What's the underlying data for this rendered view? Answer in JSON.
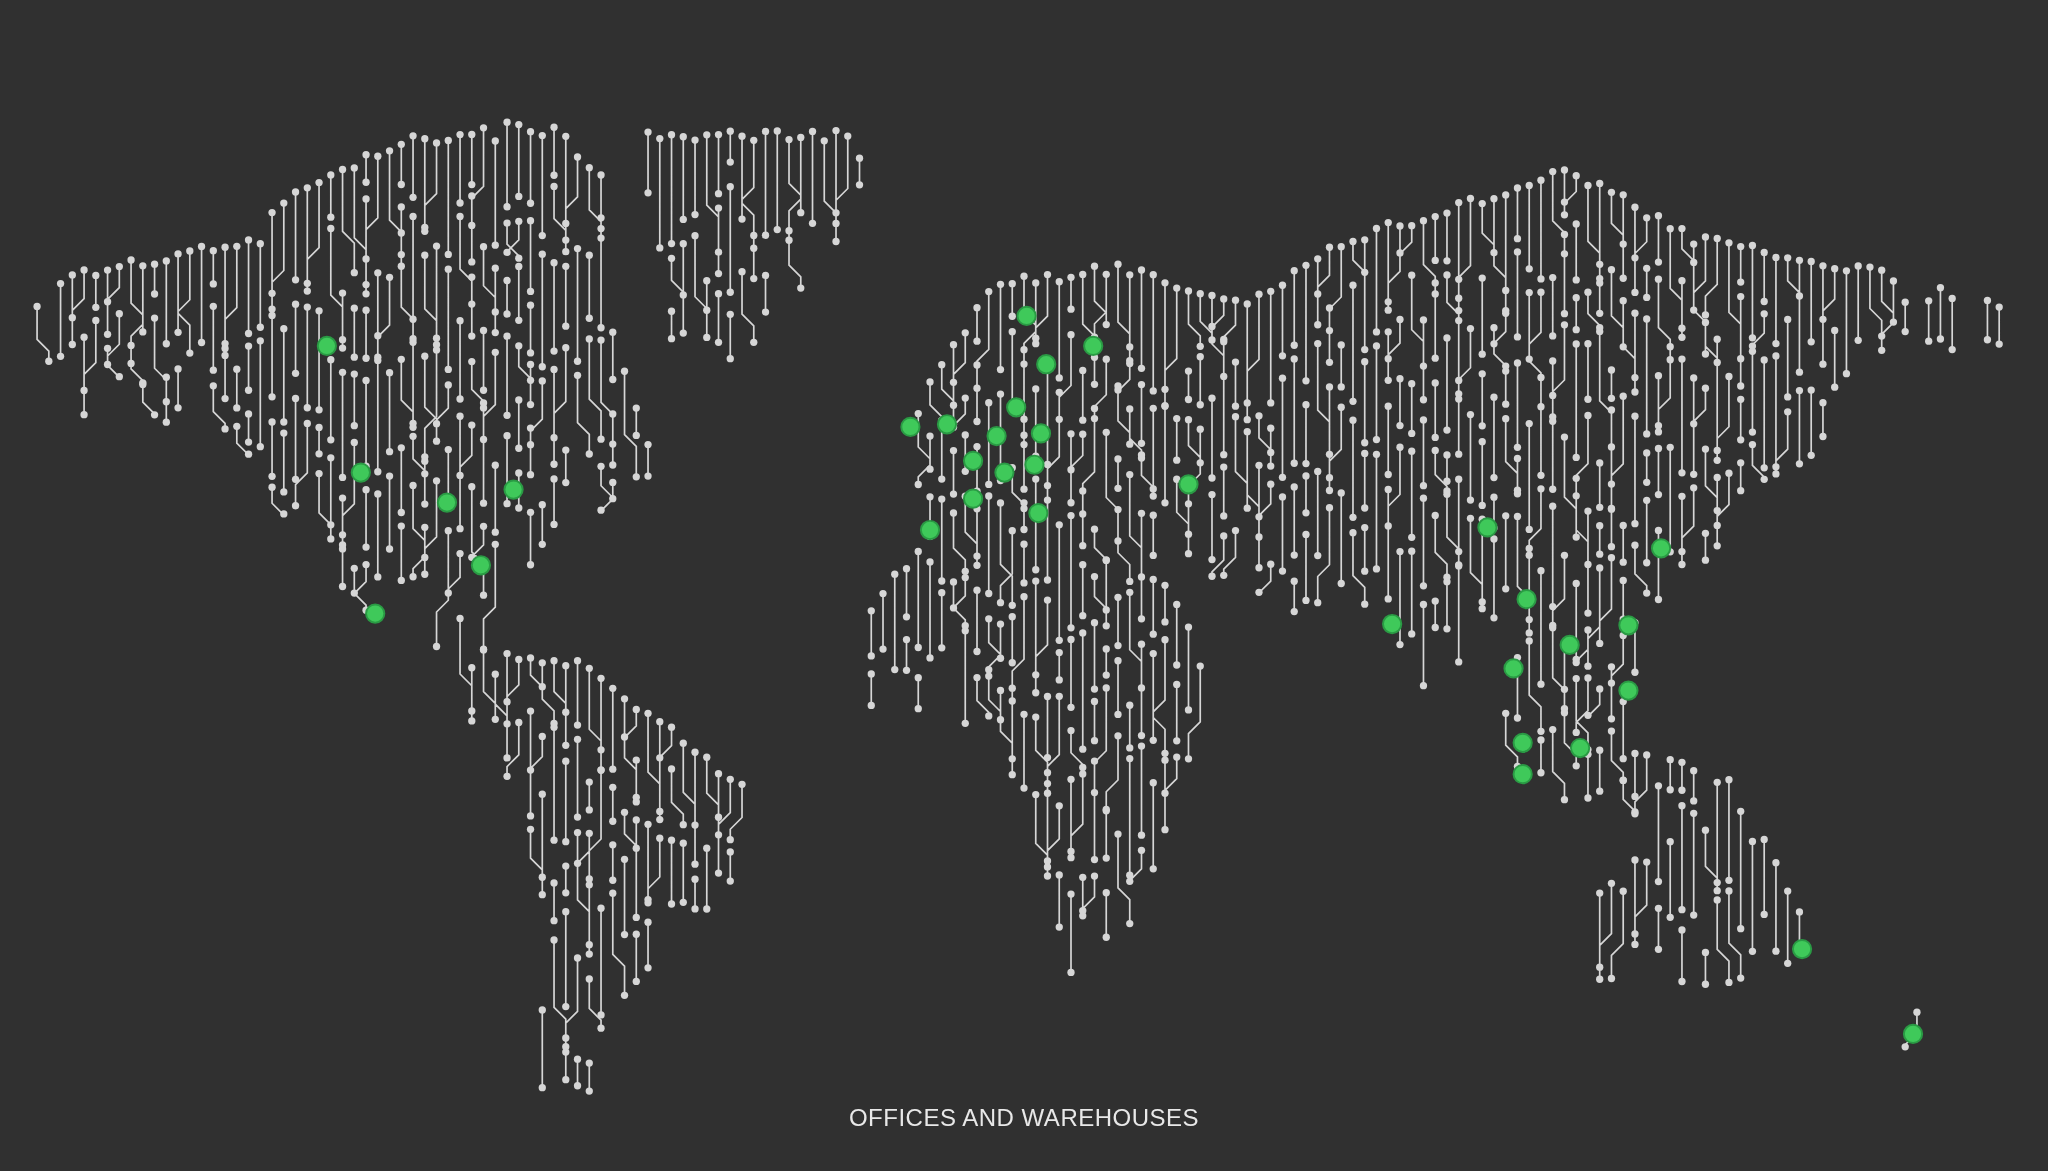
{
  "caption": "OFFICES AND WAREHOUSES"
}
